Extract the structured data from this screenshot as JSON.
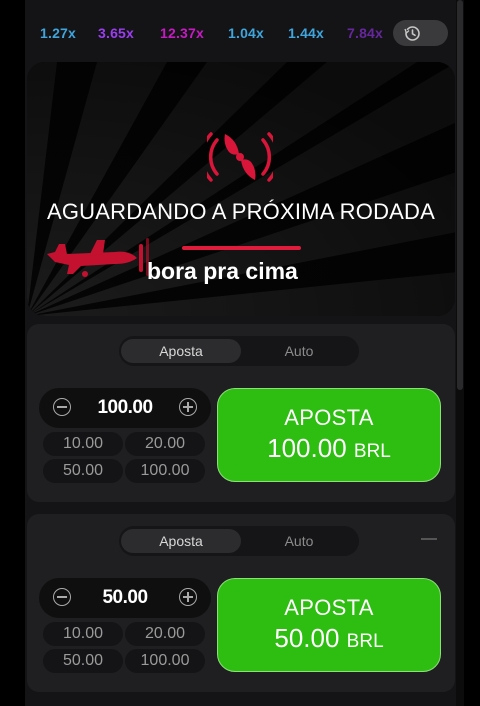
{
  "history": {
    "multipliers": [
      {
        "value": "1.27x",
        "color": "#3fa5dc"
      },
      {
        "value": "3.65x",
        "color": "#9b3df0"
      },
      {
        "value": "12.37x",
        "color": "#c71ac4"
      },
      {
        "value": "1.04x",
        "color": "#3fa5dc"
      },
      {
        "value": "1.44x",
        "color": "#3fa5dc"
      },
      {
        "value": "7.84x",
        "color": "#8a2fd6"
      }
    ],
    "button_icons": [
      "clock-history-icon",
      "caret-down-icon"
    ]
  },
  "stage": {
    "status": "AGUARDANDO A PRÓXIMA RODADA",
    "caption": "bora pra cima",
    "accent": "#e01c3c"
  },
  "bets": [
    {
      "tabs": [
        "Aposta",
        "Auto"
      ],
      "amount": "100.00",
      "quick": [
        "10.00",
        "20.00",
        "50.00",
        "100.00"
      ],
      "button_label": "APOSTA",
      "button_amount": "100.00",
      "currency": "BRL"
    },
    {
      "tabs": [
        "Aposta",
        "Auto"
      ],
      "amount": "50.00",
      "quick": [
        "10.00",
        "20.00",
        "50.00",
        "100.00"
      ],
      "button_label": "APOSTA",
      "button_amount": "50.00",
      "currency": "BRL"
    }
  ],
  "colors": {
    "bet_button": "#2ebd11",
    "panel": "#1f1f21"
  }
}
